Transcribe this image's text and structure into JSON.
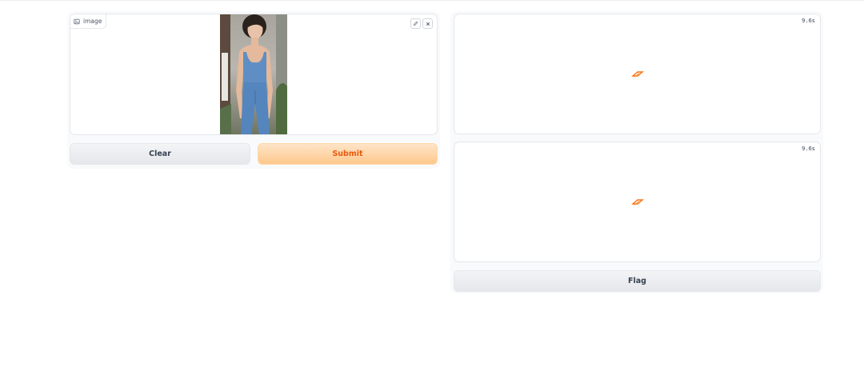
{
  "input": {
    "image_label": "image",
    "preview_alt": "woman in blue tank top and pants",
    "clear_label": "Clear",
    "submit_label": "Submit"
  },
  "outputs": [
    {
      "timer": "9.6s"
    },
    {
      "timer": "9.6s"
    }
  ],
  "flag_label": "Flag",
  "colors": {
    "accent": "#ea580c",
    "primary_bg": "#fdc88c",
    "secondary_bg": "#e5e7eb",
    "border": "#e5e7eb"
  }
}
